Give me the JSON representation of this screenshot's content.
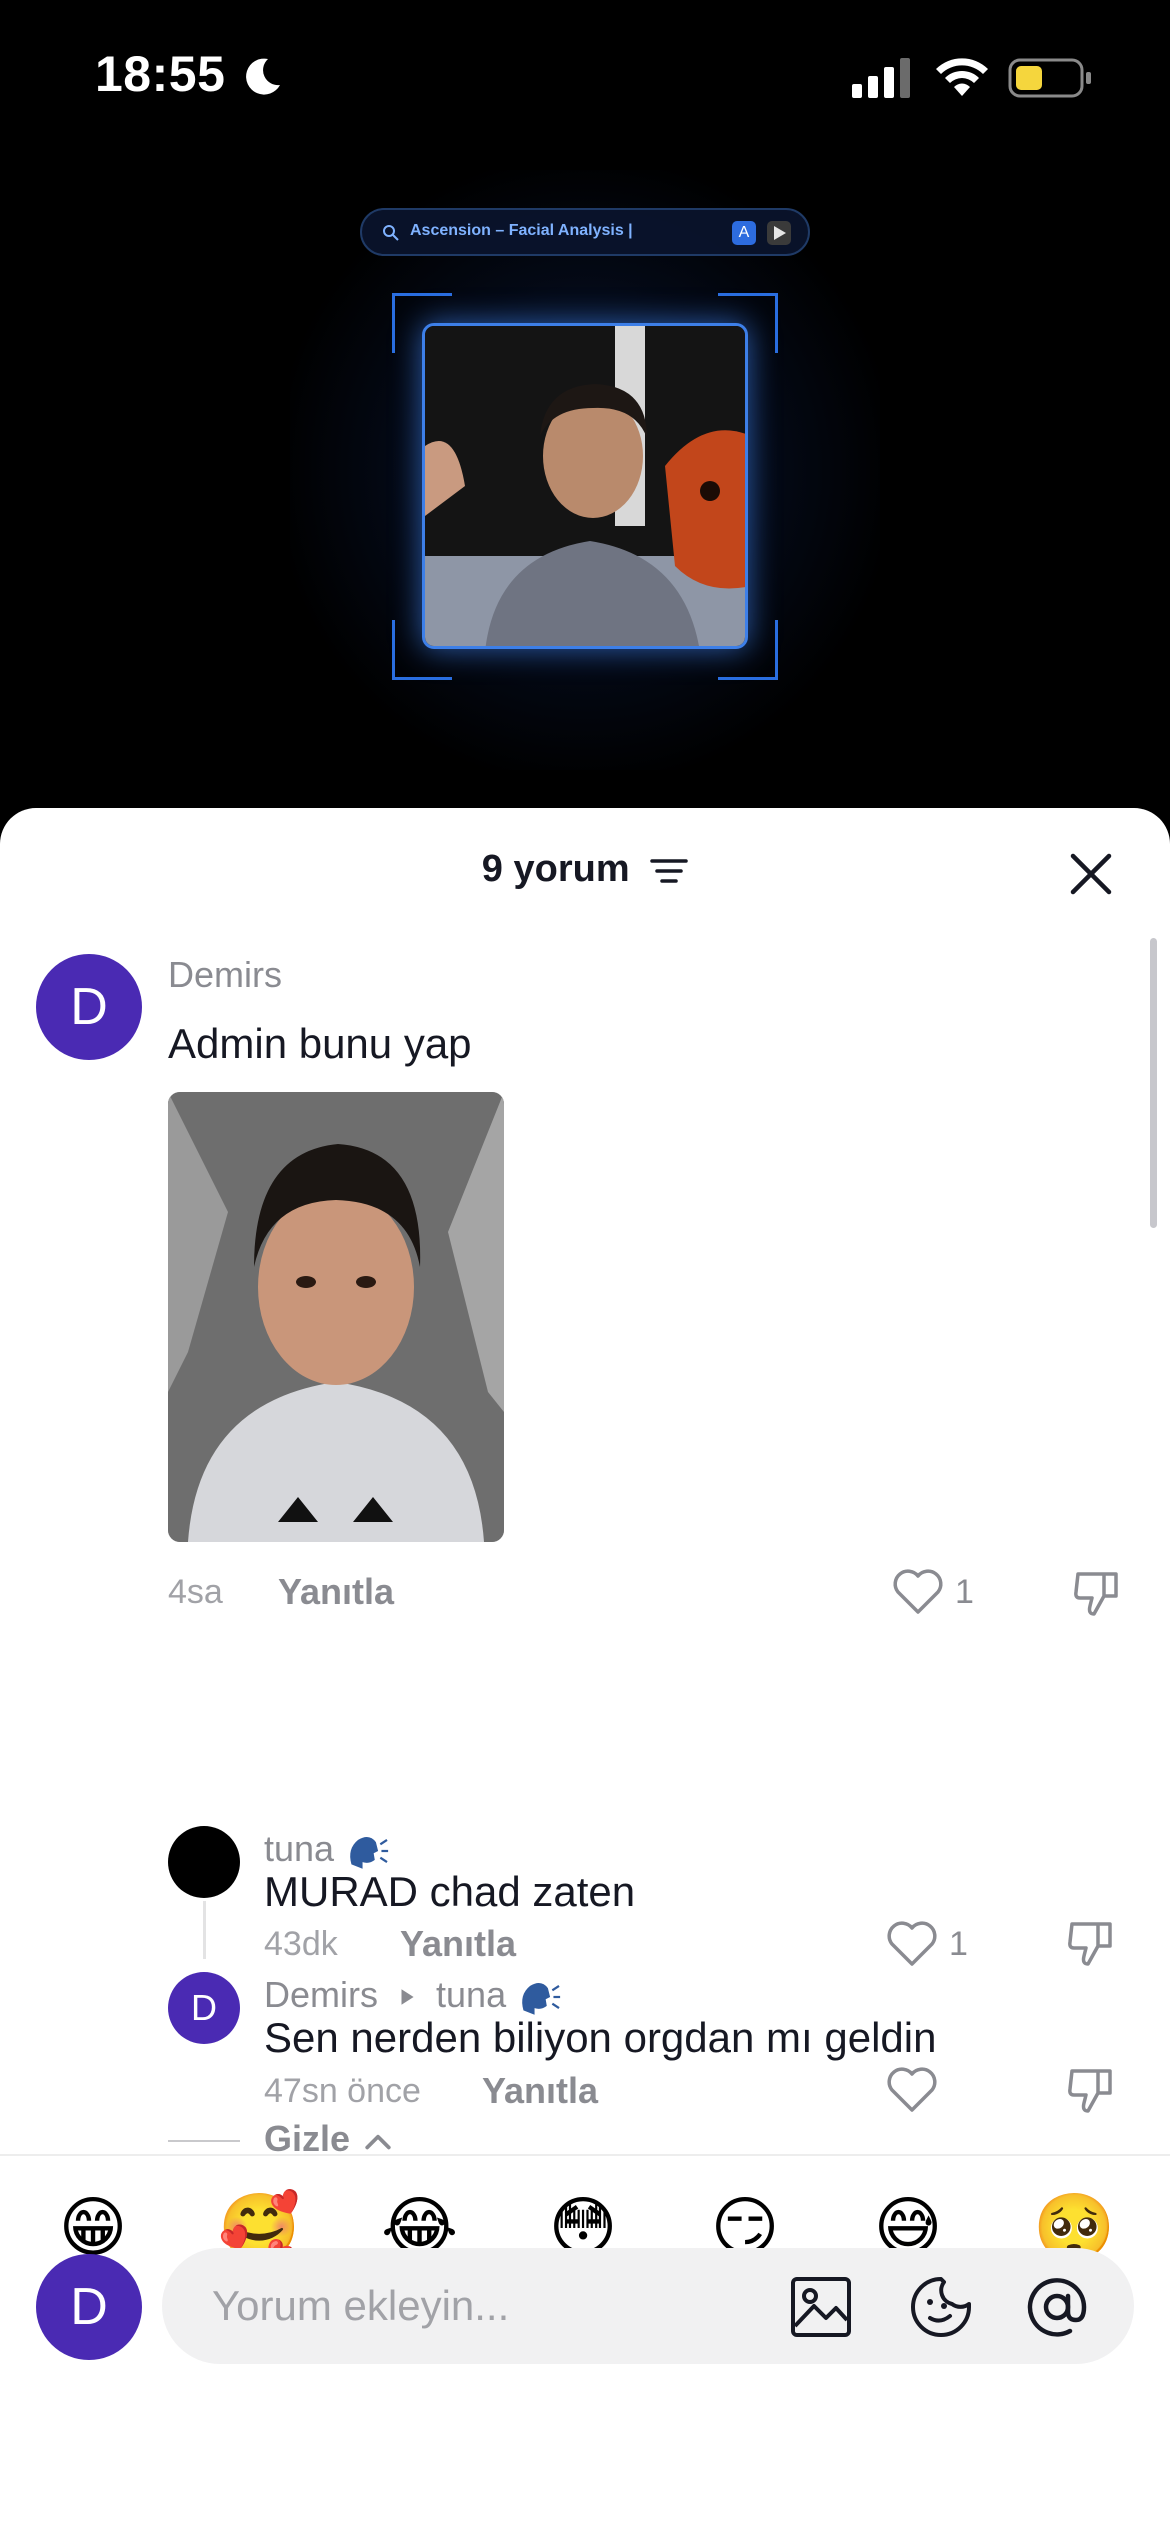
{
  "status_bar": {
    "time": "18:55",
    "icons": [
      "moon-icon",
      "signal-icon",
      "wifi-icon",
      "battery-icon"
    ]
  },
  "video": {
    "app_search_title": "Ascension – Facial Analysis |",
    "store_icons": [
      "app-store-icon",
      "play-store-icon"
    ]
  },
  "sheet": {
    "comment_count": "9 yorum",
    "close_icon": "close-icon",
    "sort_icon": "sort-icon"
  },
  "comments": [
    {
      "avatar_letter": "D",
      "username": "Demirs",
      "text": "Admin bunu yap",
      "has_image": true,
      "time": "4sa",
      "reply_label": "Yanıtla",
      "likes": "1"
    }
  ],
  "replies": [
    {
      "username": "tuna",
      "text": "MURAD chad zaten",
      "time": "43dk",
      "reply_label": "Yanıtla",
      "likes": "1"
    },
    {
      "avatar_letter": "D",
      "username": "Demirs",
      "reply_to": "tuna",
      "text": "Sen nerden biliyon orgdan mı geldin",
      "time": "47sn önce",
      "reply_label": "Yanıtla",
      "likes": ""
    }
  ],
  "hide_label": "Gizle",
  "emojis": [
    "😁",
    "🥰",
    "😂",
    "😳",
    "😏",
    "😅",
    "🥺"
  ],
  "input": {
    "avatar_letter": "D",
    "placeholder": "Yorum ekleyin...",
    "icons": [
      "image-icon",
      "sticker-icon",
      "mention-icon"
    ]
  },
  "colors": {
    "avatar_purple": "#4a2ab3",
    "text_primary": "#161823",
    "text_secondary": "#8a8b91",
    "glow_blue": "#3d7fe8"
  }
}
